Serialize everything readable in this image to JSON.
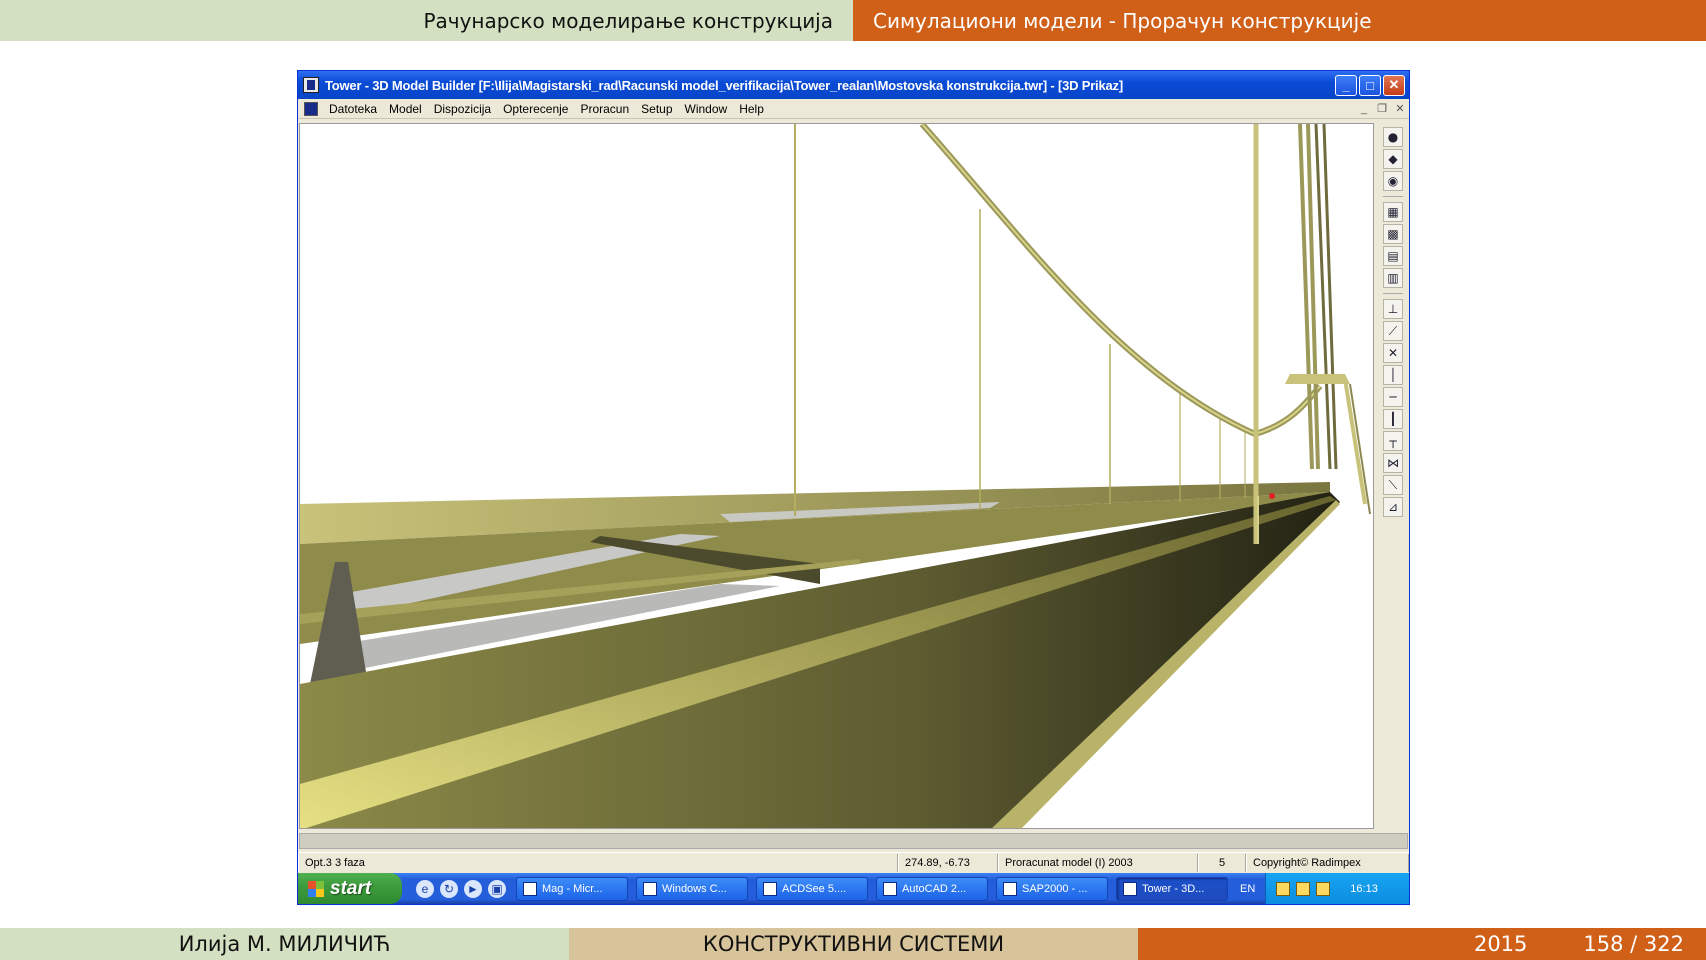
{
  "slide": {
    "header_left": "Рачунарско моделирање конструкција",
    "header_right": "Симулациони модели - Прорачун конструкције",
    "footer_author": "Илија М. МИЛИЧИЋ",
    "footer_title": "КОНСТРУКТИВНИ СИСТЕМИ",
    "footer_year": "2015",
    "footer_page": "158 / 322"
  },
  "window": {
    "title": "Tower - 3D Model Builder [F:\\Ilija\\Magistarski_rad\\Racunski model_verifikacija\\Tower_realan\\Mostovska konstrukcija.twr] - [3D Prikaz]",
    "controls": {
      "minimize": "_",
      "maximize": "□",
      "close": "✕"
    }
  },
  "menu": {
    "items": [
      "Datoteka",
      "Model",
      "Dispozicija",
      "Opterecenje",
      "Proracun",
      "Setup",
      "Window",
      "Help"
    ]
  },
  "toolbar_icons": [
    "sphere-icon",
    "render-icon",
    "model-icon",
    "grid-icon",
    "mesh-icon",
    "frame-icon",
    "table-icon",
    "axis-icon",
    "diag-icon",
    "cross-icon",
    "line-icon",
    "hline-icon",
    "column-icon",
    "beam-icon",
    "truss-icon",
    "brace-icon",
    "support-icon"
  ],
  "statusbar": {
    "phase": "Opt.3 3 faza",
    "coords": "274.89, -6.73",
    "model": "Proracunat model (I)   2003",
    "count": "5",
    "copyright": "Copyright© Radimpex"
  },
  "taskbar": {
    "start": "start",
    "tasks": [
      {
        "label": "Mag - Micr...",
        "active": false
      },
      {
        "label": "Windows C...",
        "active": false
      },
      {
        "label": "ACDSee 5....",
        "active": false
      },
      {
        "label": "AutoCAD 2...",
        "active": false
      },
      {
        "label": "SAP2000 - ...",
        "active": false
      },
      {
        "label": "Tower - 3D...",
        "active": true
      }
    ],
    "lang": "EN",
    "clock": "16:13"
  },
  "colors": {
    "deck_olive": "#7d7a3a",
    "deck_light": "#d8d27a",
    "titlebar": "#0a4bd6",
    "header_green": "#d4e0c2",
    "header_orange": "#d06018"
  }
}
